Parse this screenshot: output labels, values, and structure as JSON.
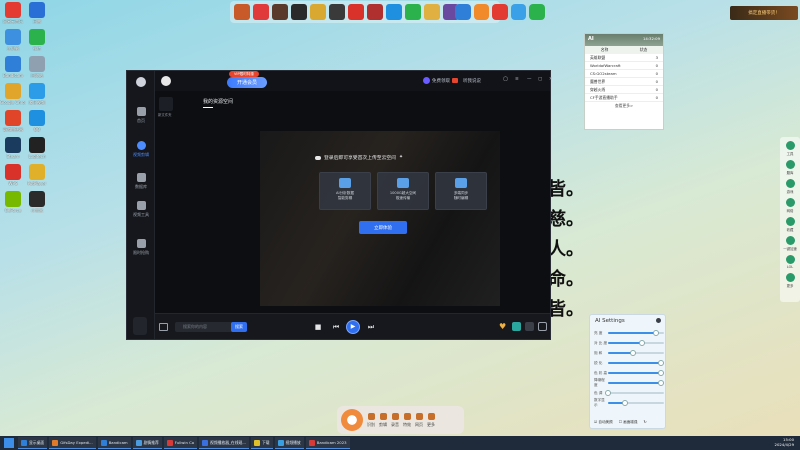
{
  "desktop": {
    "icons": [
      {
        "label": "网易云音乐",
        "color": "#e33a32"
      },
      {
        "label": "迅雷",
        "color": "#2a6fd6"
      },
      {
        "label": "此电脑",
        "color": "#3d8fe0"
      },
      {
        "label": "微信",
        "color": "#2bb24c"
      },
      {
        "label": "Bandicam",
        "color": "#2f7fd8"
      },
      {
        "label": "回收站",
        "color": "#8fa0b0"
      },
      {
        "label": "Google Chrome",
        "color": "#e0a52a"
      },
      {
        "label": "腾讯视频",
        "color": "#2c9be8"
      },
      {
        "label": "奇游加速器",
        "color": "#e0452a"
      },
      {
        "label": "QQ",
        "color": "#1f8fe0"
      },
      {
        "label": "Steam",
        "color": "#1b3b5e"
      },
      {
        "label": "Logitech",
        "color": "#222222"
      },
      {
        "label": "WPS",
        "color": "#d8322a"
      },
      {
        "label": "PotPlayer",
        "color": "#e0b02a"
      },
      {
        "label": "GeForce",
        "color": "#76b900"
      },
      {
        "label": "小黑盒",
        "color": "#2b2b2b"
      }
    ]
  },
  "banner": {
    "text": "搞定直播带货！"
  },
  "poem": {
    "lines": [
      "皆。",
      "慈。",
      "人。",
      "命。",
      "皆。"
    ]
  },
  "window": {
    "vip_tag": "VIP限时特惠",
    "open_vip": "开通会员",
    "titlebar": {
      "free_label": "免费领取",
      "feedback": "听我说说",
      "min": "—",
      "max": "▢",
      "close": "✕"
    },
    "sidebar": [
      {
        "label": "首页"
      },
      {
        "label": "视频剪辑"
      },
      {
        "label": "数据库"
      },
      {
        "label": "视频工具"
      },
      {
        "label": "限时抢购"
      }
    ],
    "tab_title": "我的资源空间",
    "folder_label": "新文件夹",
    "notice": "登录后即可享受首次上传至云空间",
    "cards": [
      {
        "line1": "AI分析数据",
        "line2": "智能剪辑"
      },
      {
        "line1": "1000G超大空间",
        "line2": "极速传输"
      },
      {
        "line1": "多端同步",
        "line2": "随时编辑"
      }
    ],
    "experience_btn": "立即体验",
    "time_start": "00:00:00",
    "time_end": "00:00:00",
    "search_placeholder": "搜索你的内容",
    "search_btn": "搜索"
  },
  "widget": {
    "title": "AI",
    "time": "14:32:09",
    "tabs": [
      "名称",
      "状态"
    ],
    "rows": [
      {
        "name": "英雄联盟",
        "value": "3"
      },
      {
        "name": "WorldofWarcraft",
        "value": "0"
      },
      {
        "name": "CS:GO2steam",
        "value": "0"
      },
      {
        "name": "魔兽世界",
        "value": "0"
      },
      {
        "name": "穿越火线",
        "value": "0"
      },
      {
        "name": "CF手游直播助手",
        "value": "0"
      }
    ],
    "footer": "查看更多>"
  },
  "ai_settings": {
    "title": "AI Settings",
    "rows": [
      {
        "label": "亮 度",
        "level": 0.85
      },
      {
        "label": "对 比 度",
        "level": 0.6
      },
      {
        "label": "饱 和",
        "level": 0.45
      },
      {
        "label": "锐 化",
        "level": 0.95
      },
      {
        "label": "色 彩 高",
        "level": 0.95
      },
      {
        "label": "降噪程度",
        "level": 0.95
      },
      {
        "label": "色 调",
        "level": 0.0
      },
      {
        "label": "数字显示",
        "level": 0.3
      }
    ],
    "footer": [
      "自动美颜",
      "画面增强"
    ]
  },
  "right_bar": [
    {
      "label": "工具"
    },
    {
      "label": "题库"
    },
    {
      "label": "游戏"
    },
    {
      "label": "网络"
    },
    {
      "label": "收藏"
    },
    {
      "label": "一键加速"
    },
    {
      "label": "LOL"
    },
    {
      "label": "更多"
    }
  ],
  "float_bar": [
    {
      "label": "识别"
    },
    {
      "label": "剪辑"
    },
    {
      "label": "录音"
    },
    {
      "label": "特效"
    },
    {
      "label": "网页"
    },
    {
      "label": "更多"
    }
  ],
  "taskbar": {
    "items": [
      {
        "label": "显示桌面",
        "color": "#2f7fd8"
      },
      {
        "label": "GifsDay Expedi...",
        "color": "#e07a2a"
      },
      {
        "label": "Bandicam",
        "color": "#2f7fd8"
      },
      {
        "label": "剧情推荐",
        "color": "#4a9be0"
      },
      {
        "label": "Fullwin Co",
        "color": "#d83a3a"
      },
      {
        "label": "视频播放器_在线观...",
        "color": "#3a6fe0"
      },
      {
        "label": "下载",
        "color": "#e0c02a"
      },
      {
        "label": "视频播放",
        "color": "#3a9fe0"
      },
      {
        "label": "Bandicam 2023",
        "color": "#d83a3a"
      }
    ],
    "time": "15:00",
    "date": "2024/4/29"
  }
}
